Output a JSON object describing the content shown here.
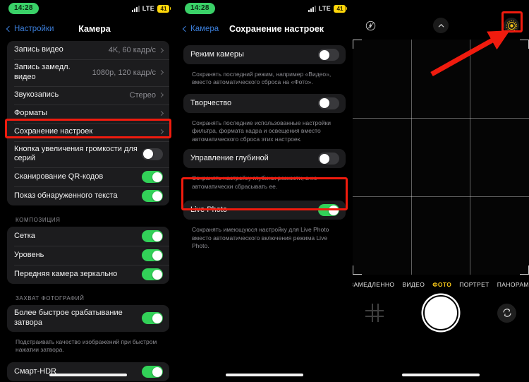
{
  "status_bar": {
    "time": "14:28",
    "network": "LTE",
    "battery": "41",
    "time_pill_color": "#3ad168",
    "battery_color": "#ffd60a"
  },
  "accent": {
    "highlight_red": "#f01b0e",
    "toggle_on_green": "#32d158",
    "link_blue": "#3b7dd8",
    "active_mode_yellow": "#f5c518"
  },
  "screen_camera_settings": {
    "back_label": "Настройки",
    "title": "Камера",
    "groups": [
      {
        "rows": [
          {
            "label": "Запись видео",
            "value": "4K, 60 кадр/с",
            "type": "disclosure"
          },
          {
            "label": "Запись замедл. видео",
            "value": "1080p, 120 кадр/с",
            "type": "disclosure"
          },
          {
            "label": "Звукозапись",
            "value": "Стерео",
            "type": "disclosure"
          },
          {
            "label": "Форматы",
            "value": "",
            "type": "disclosure"
          },
          {
            "label": "Сохранение настроек",
            "value": "",
            "type": "disclosure",
            "highlighted": true
          },
          {
            "label": "Кнопка увеличения громкости для серий",
            "type": "toggle",
            "on": false
          },
          {
            "label": "Сканирование QR-кодов",
            "type": "toggle",
            "on": true
          },
          {
            "label": "Показ обнаруженного текста",
            "type": "toggle",
            "on": true
          }
        ]
      }
    ],
    "section_composition": {
      "header": "КОМПОЗИЦИЯ",
      "rows": [
        {
          "label": "Сетка",
          "type": "toggle",
          "on": true
        },
        {
          "label": "Уровень",
          "type": "toggle",
          "on": true
        },
        {
          "label": "Передняя камера зеркально",
          "type": "toggle",
          "on": true
        }
      ]
    },
    "section_capture": {
      "header": "ЗАХВАТ ФОТОГРАФИЙ",
      "rows": [
        {
          "label": "Более быстрое срабатывание затвора",
          "type": "toggle",
          "on": true
        }
      ],
      "footnote": "Подстраивать качество изображений при быстром нажатии затвора."
    },
    "section_hdr": {
      "rows": [
        {
          "label": "Смарт-HDR",
          "type": "toggle",
          "on": true
        }
      ]
    }
  },
  "screen_preserve_settings": {
    "back_label": "Камера",
    "title": "Сохранение настроек",
    "items": [
      {
        "label": "Режим камеры",
        "on": false,
        "footnote": "Сохранять последний режим, например «Видео», вместо автоматического сброса на «Фото».",
        "highlighted": false
      },
      {
        "label": "Творчество",
        "on": false,
        "footnote": "Сохранять последние использованные настройки фильтра, формата кадра и освещения вместо автоматического сброса этих настроек.",
        "highlighted": false
      },
      {
        "label": "Управление глубиной",
        "on": false,
        "footnote": "Сохранять настройку глубины резкости, а не автоматически сбрасывать ее.",
        "highlighted": false
      },
      {
        "label": "Live Photo",
        "on": true,
        "footnote": "Сохранять имеющуюся настройку для Live Photo вместо автоматического включения режима Live Photo.",
        "highlighted": true
      }
    ]
  },
  "screen_camera_viewfinder": {
    "top_controls": [
      {
        "icon": "flash-off-icon",
        "label": "Вспышка выкл."
      },
      {
        "icon": "chevron-up-icon",
        "label": "Дополнительные настройки"
      },
      {
        "icon": "live-photo-icon",
        "label": "Live Photo",
        "active": true,
        "highlighted": true
      }
    ],
    "modes": [
      {
        "label": "ЗАМЕДЛЕННО",
        "active": false
      },
      {
        "label": "ВИДЕО",
        "active": false
      },
      {
        "label": "ФОТО",
        "active": true
      },
      {
        "label": "ПОРТРЕТ",
        "active": false
      },
      {
        "label": "ПАНОРАМА",
        "active": false
      }
    ],
    "bottom_controls": [
      {
        "name": "photo-library-thumbnail"
      },
      {
        "name": "shutter-button"
      },
      {
        "name": "flip-camera-button"
      }
    ],
    "grid_enabled": true
  },
  "annotations": {
    "arrow": {
      "name": "red-pointer-arrow",
      "points_to": "live-photo-icon"
    }
  }
}
